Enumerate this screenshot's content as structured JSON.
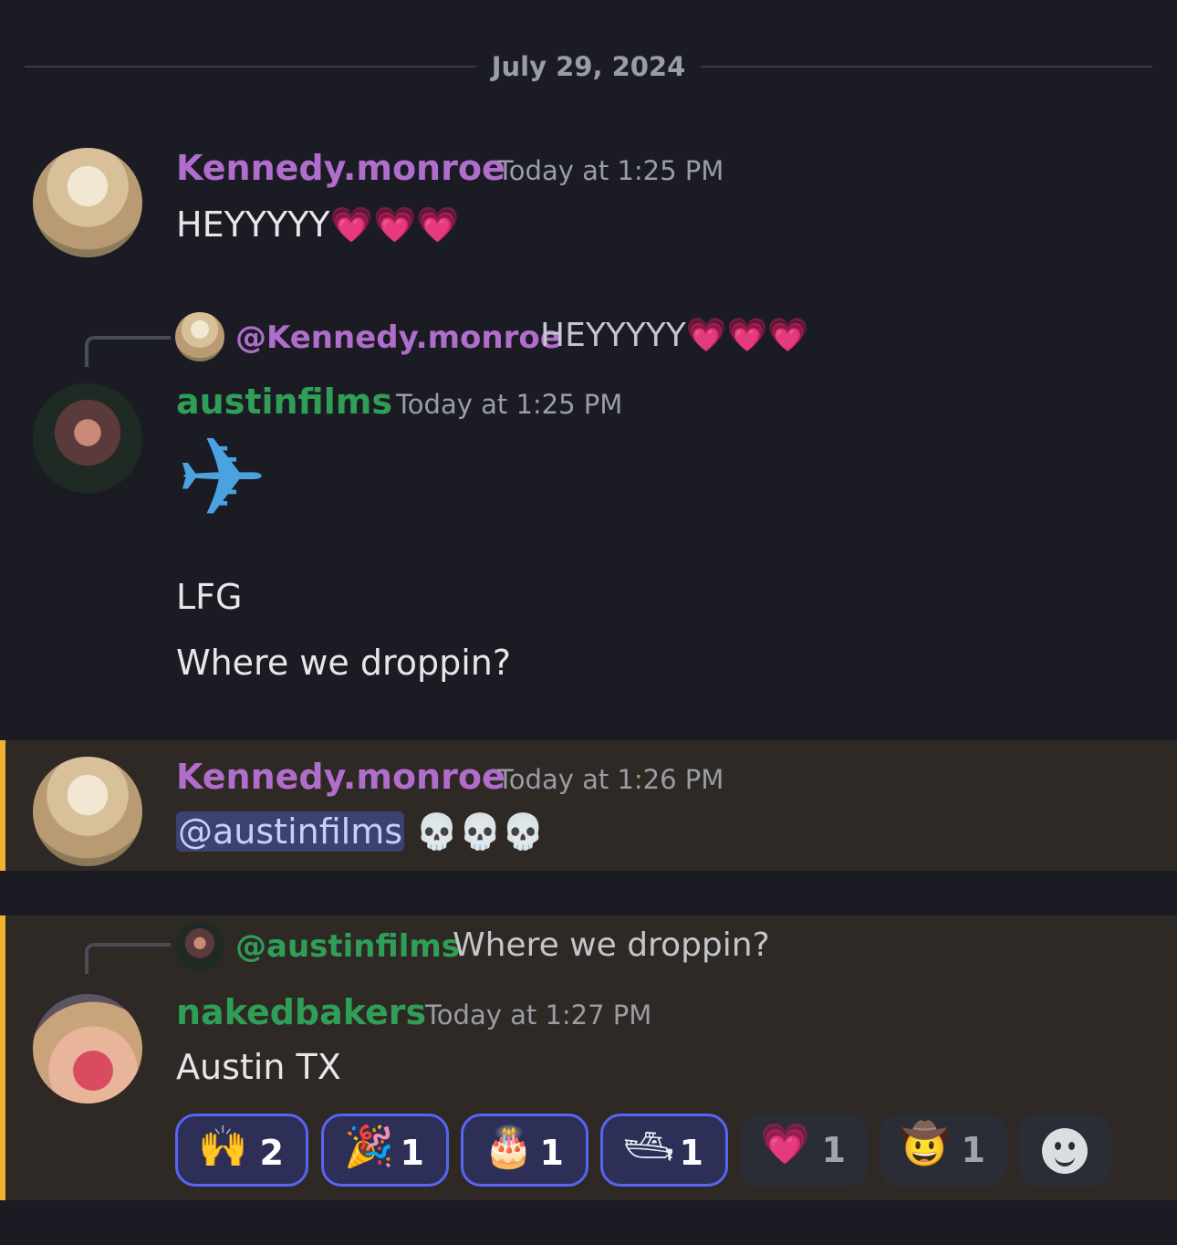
{
  "date_divider": "July 29, 2024",
  "messages": [
    {
      "author": "Kennedy.monroe",
      "timestamp": "Today at 1:25 PM",
      "text": "HEYYYYY",
      "emojis": "💗💗💗"
    },
    {
      "reply": {
        "mention": "@Kennedy.monroe",
        "text": "HEYYYYY",
        "emojis": "💗💗💗"
      },
      "author": "austinfilms",
      "timestamp": "Today at 1:25 PM",
      "big_emoji": "✈",
      "lines": [
        "LFG",
        "Where we droppin?"
      ]
    },
    {
      "author": "Kennedy.monroe",
      "timestamp": "Today at 1:26 PM",
      "mention": "@austinfilms",
      "emojis": "💀💀💀"
    },
    {
      "reply": {
        "mention": "@austinfilms",
        "text": "Where we droppin?"
      },
      "author": "nakedbakers",
      "timestamp": "Today at 1:27 PM",
      "text": "Austin TX",
      "reactions": [
        {
          "emoji": "🙌",
          "count": "2",
          "me": true
        },
        {
          "emoji": "🎉",
          "count": "1",
          "me": true
        },
        {
          "emoji": "🎂",
          "count": "1",
          "me": true
        },
        {
          "emoji": "🛥",
          "count": "1",
          "me": true
        },
        {
          "emoji": "💗",
          "count": "1",
          "me": false
        },
        {
          "emoji": "🤠",
          "count": "1",
          "me": false
        }
      ]
    }
  ],
  "colors": {
    "background": "#1b1c23",
    "highlight": "#2e2924",
    "highlight_bar": "#f0b232",
    "purple_name": "#b06dcc",
    "green_name": "#2f9e56",
    "mention_bg": "#3d4172",
    "reaction_accent": "#5865f2"
  }
}
